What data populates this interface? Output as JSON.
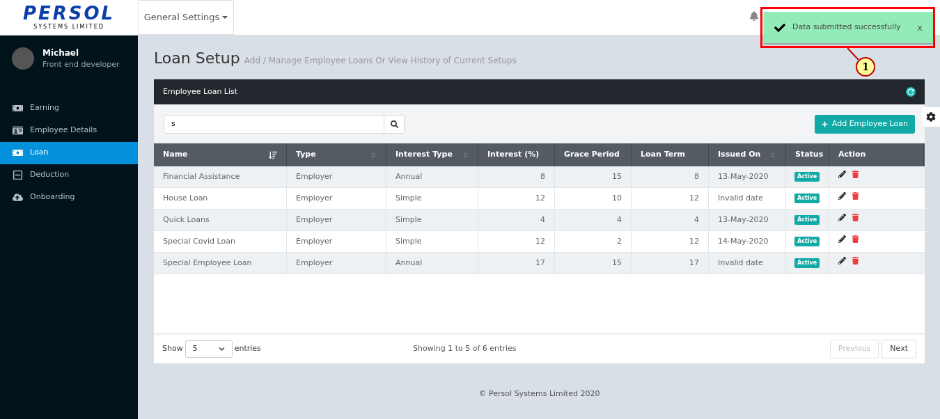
{
  "header": {
    "logo": {
      "name": "PERSOL",
      "tagline": "SYSTEMS LIMITED"
    },
    "menu": "General Settings"
  },
  "user": {
    "name": "Michael",
    "role": "Front end developer"
  },
  "sidebar": {
    "items": [
      {
        "label": "Earning",
        "selected": false
      },
      {
        "label": "Employee Details",
        "selected": false
      },
      {
        "label": "Loan",
        "selected": true
      },
      {
        "label": "Deduction",
        "selected": false
      },
      {
        "label": "Onboarding",
        "selected": false
      }
    ]
  },
  "page": {
    "title": "Loan Setup",
    "subtitle": "Add / Manage Employee Loans Or View History of Current Setups"
  },
  "panel": {
    "title": "Employee Loan List",
    "search": {
      "value": "s"
    },
    "add_button": "Add Employee Loan"
  },
  "table": {
    "columns": [
      {
        "label": "Name",
        "sorted": true
      },
      {
        "label": "Type",
        "sorted": false
      },
      {
        "label": "Interest Type",
        "sorted": false
      },
      {
        "label": "Interest (%)"
      },
      {
        "label": "Grace Period"
      },
      {
        "label": "Loan Term"
      },
      {
        "label": "Issued On",
        "sorted": false
      },
      {
        "label": "Status"
      },
      {
        "label": "Action"
      }
    ],
    "rows": [
      {
        "cells": [
          "Financial Assistance",
          "Employer",
          "Annual",
          "8",
          "15",
          "8",
          "13-May-2020"
        ],
        "status": "Active"
      },
      {
        "cells": [
          "House Loan",
          "Employer",
          "Simple",
          "12",
          "10",
          "12",
          "Invalid date"
        ],
        "status": "Active"
      },
      {
        "cells": [
          "Quick Loans",
          "Employer",
          "Simple",
          "4",
          "4",
          "4",
          "13-May-2020"
        ],
        "status": "Active"
      },
      {
        "cells": [
          "Special Covid Loan",
          "Employer",
          "Simple",
          "12",
          "2",
          "12",
          "14-May-2020"
        ],
        "status": "Active"
      },
      {
        "cells": [
          "Special Employee Loan",
          "Employer",
          "Annual",
          "17",
          "15",
          "17",
          "Invalid date"
        ],
        "status": "Active"
      }
    ]
  },
  "footer_bar": {
    "show": "Show",
    "page_size": "5",
    "entries": "entries",
    "info": "Showing 1 to 5 of 6 entries",
    "previous": {
      "label": "Previous",
      "disabled": true
    },
    "next": {
      "label": "Next",
      "disabled": false
    }
  },
  "copyright": "© Persol Systems Limited 2020",
  "toast": {
    "message": "Data submitted successfully",
    "close": "x"
  },
  "callout": {
    "number": "1"
  }
}
